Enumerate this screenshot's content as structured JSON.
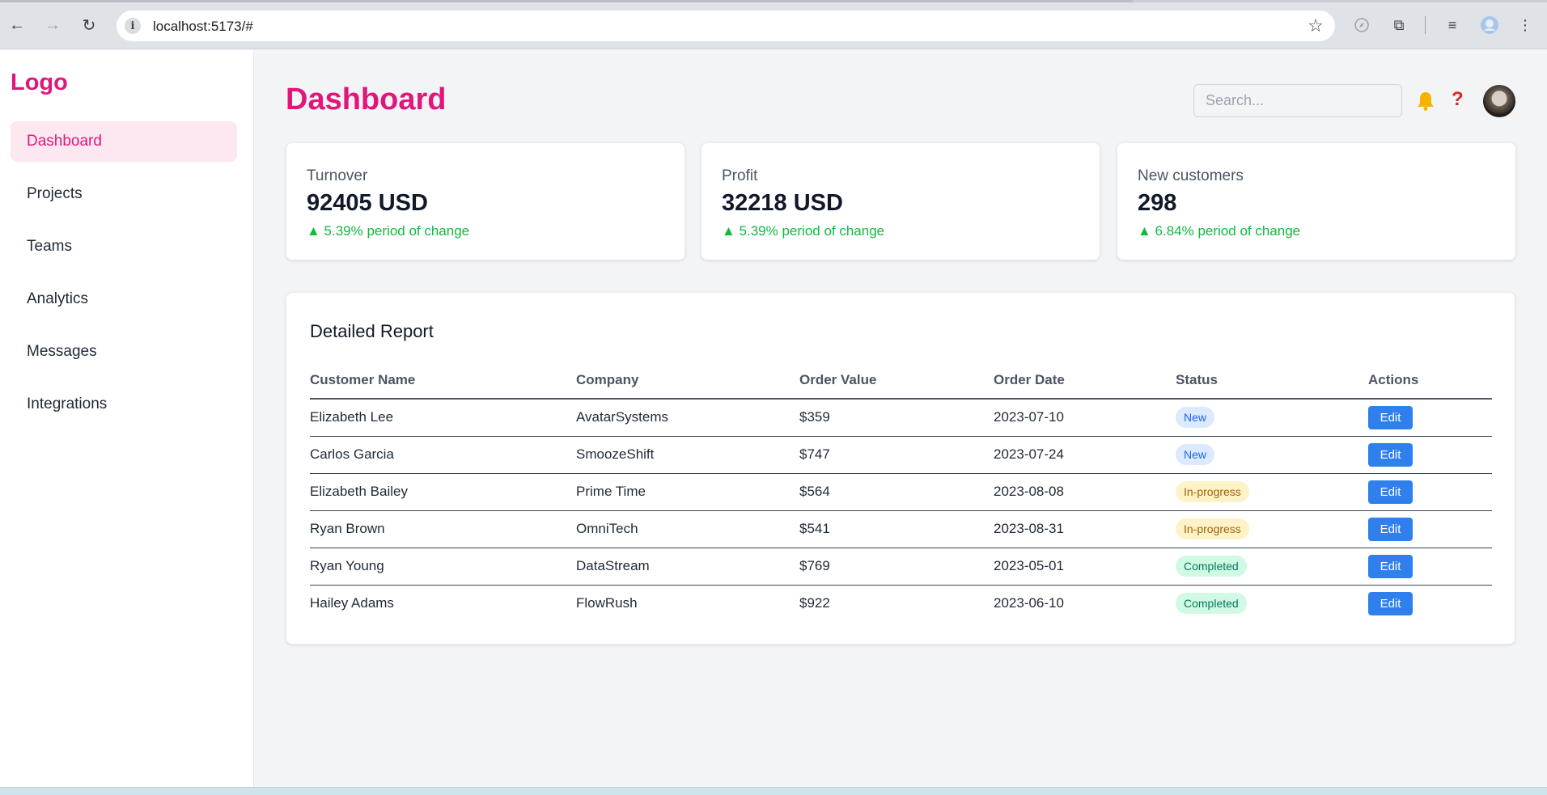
{
  "browser": {
    "url": "localhost:5173/#",
    "back_icon": "←",
    "forward_icon": "→",
    "reload_icon": "↻",
    "info_icon": "i",
    "star_icon": "☆",
    "puzzle_icon": "⧉",
    "media_icon": "≡",
    "menu_icon": "⋮"
  },
  "sidebar": {
    "logo": "Logo",
    "items": [
      {
        "label": "Dashboard"
      },
      {
        "label": "Projects"
      },
      {
        "label": "Teams"
      },
      {
        "label": "Analytics"
      },
      {
        "label": "Messages"
      },
      {
        "label": "Integrations"
      }
    ]
  },
  "header": {
    "title": "Dashboard",
    "search_placeholder": "Search...",
    "help_icon": "?"
  },
  "cards": [
    {
      "label": "Turnover",
      "value": "92405 USD",
      "change": "▲ 5.39% period of change"
    },
    {
      "label": "Profit",
      "value": "32218 USD",
      "change": "▲ 5.39% period of change"
    },
    {
      "label": "New customers",
      "value": "298",
      "change": "▲ 6.84% period of change"
    }
  ],
  "report": {
    "title": "Detailed Report",
    "columns": [
      "Customer Name",
      "Company",
      "Order Value",
      "Order Date",
      "Status",
      "Actions"
    ],
    "edit_label": "Edit",
    "rows": [
      {
        "name": "Elizabeth Lee",
        "company": "AvatarSystems",
        "value": "$359",
        "date": "2023-07-10",
        "status": "New"
      },
      {
        "name": "Carlos Garcia",
        "company": "SmoozeShift",
        "value": "$747",
        "date": "2023-07-24",
        "status": "New"
      },
      {
        "name": "Elizabeth Bailey",
        "company": "Prime Time",
        "value": "$564",
        "date": "2023-08-08",
        "status": "In-progress"
      },
      {
        "name": "Ryan Brown",
        "company": "OmniTech",
        "value": "$541",
        "date": "2023-08-31",
        "status": "In-progress"
      },
      {
        "name": "Ryan Young",
        "company": "DataStream",
        "value": "$769",
        "date": "2023-05-01",
        "status": "Completed"
      },
      {
        "name": "Hailey Adams",
        "company": "FlowRush",
        "value": "$922",
        "date": "2023-06-10",
        "status": "Completed"
      }
    ]
  },
  "colors": {
    "brand": "#e0177a",
    "positive": "#10b93f",
    "edit_button": "#2f80ed"
  }
}
